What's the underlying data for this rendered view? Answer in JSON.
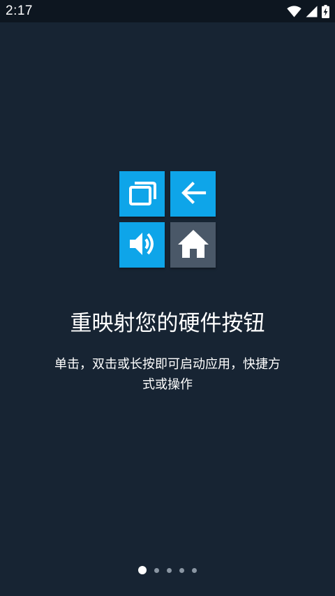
{
  "status_bar": {
    "time": "2:17",
    "icons": [
      "wifi-icon",
      "cell-signal-icon",
      "battery-charging-icon"
    ]
  },
  "tiles": [
    {
      "name": "recents-icon",
      "color": "#0ea5e9"
    },
    {
      "name": "back-arrow-icon",
      "color": "#0ea5e9"
    },
    {
      "name": "volume-icon",
      "color": "#0ea5e9"
    },
    {
      "name": "home-icon",
      "color": "#4a5868"
    }
  ],
  "onboarding": {
    "title": "重映射您的硬件按钮",
    "description": "单击，双击或长按即可启动应用，快捷方式或操作"
  },
  "pager": {
    "page_count": 5,
    "active_page": 1
  },
  "colors": {
    "background": "#172433",
    "status_bar": "#0d1620",
    "accent": "#0ea5e9",
    "tile_gray": "#4a5868"
  }
}
